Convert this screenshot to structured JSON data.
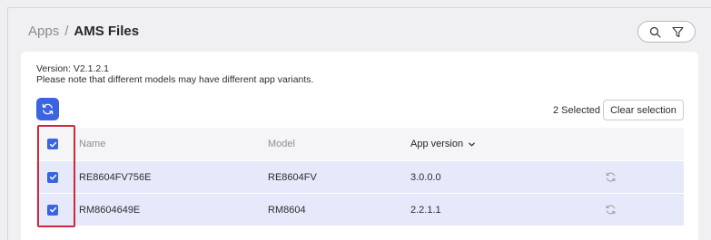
{
  "breadcrumb": {
    "parent": "Apps",
    "separator": "/",
    "current": "AMS Files"
  },
  "toolbar": {
    "icons": [
      "search-icon",
      "filter-icon"
    ]
  },
  "info": {
    "version": "Version: V2.1.2.1",
    "note": "Please note that different models may have different app variants."
  },
  "selection": {
    "count_text": "2 Selected",
    "clear_label": "Clear selection"
  },
  "table": {
    "headers": {
      "name": "Name",
      "model": "Model",
      "app_version": "App version"
    },
    "sorted_column": "app_version",
    "rows": [
      {
        "checked": true,
        "name": "RE8604FV756E",
        "model": "RE8604FV",
        "app_version": "3.0.0.0"
      },
      {
        "checked": true,
        "name": "RM8604649E",
        "model": "RM8604",
        "app_version": "2.2.1.1"
      }
    ]
  },
  "colors": {
    "accent": "#3c63e0",
    "selected_row": "#e6e9f9",
    "highlight": "#cc2a3c"
  }
}
